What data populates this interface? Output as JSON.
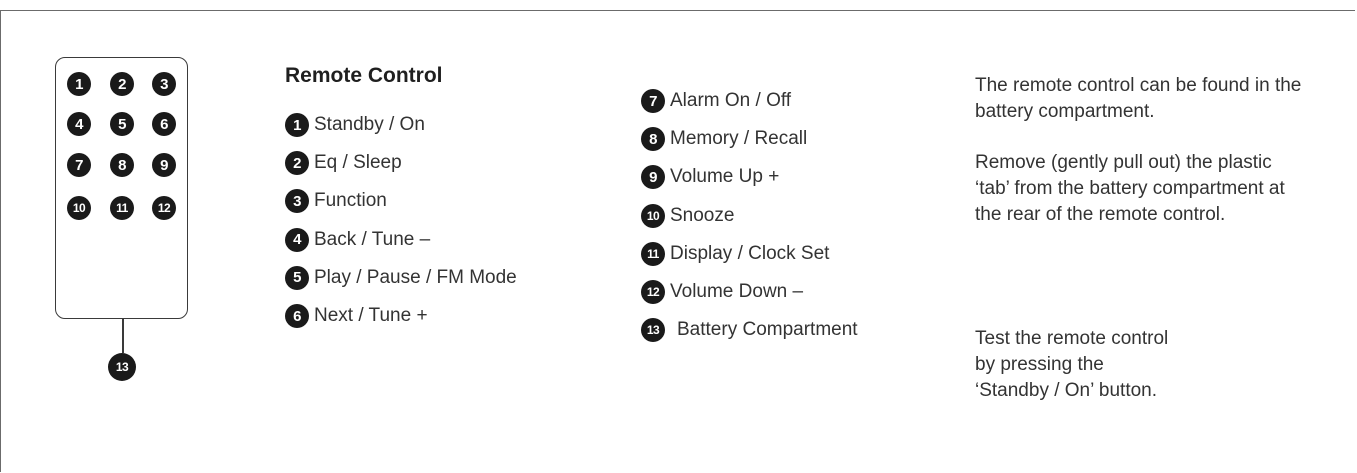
{
  "title": "Remote Control",
  "remote_buttons": [
    "1",
    "2",
    "3",
    "4",
    "5",
    "6",
    "7",
    "8",
    "9",
    "10",
    "11",
    "12"
  ],
  "remote_cord_number": "13",
  "legend_left": [
    {
      "num": "1",
      "label": "Standby / On"
    },
    {
      "num": "2",
      "label": "Eq / Sleep"
    },
    {
      "num": "3",
      "label": "Function"
    },
    {
      "num": "4",
      "label": "Back / Tune –"
    },
    {
      "num": "5",
      "label": "Play / Pause / FM Mode"
    },
    {
      "num": "6",
      "label": "Next / Tune +"
    }
  ],
  "legend_right": [
    {
      "num": "7",
      "label": "Alarm On / Off"
    },
    {
      "num": "8",
      "label": "Memory / Recall"
    },
    {
      "num": "9",
      "label": "Volume Up +"
    },
    {
      "num": "10",
      "label": "Snooze"
    },
    {
      "num": "11",
      "label": "Display / Clock Set"
    },
    {
      "num": "12",
      "label": "Volume Down –"
    },
    {
      "num": "13",
      "label": "Battery Compartment"
    }
  ],
  "paragraphs": [
    "The remote control can be found in the battery compartment.",
    "Remove (gently pull out) the plastic ‘tab’ from the battery compartment at the rear of the remote control.",
    "Test the remote control by pressing the ‘Standby / On’ button."
  ]
}
